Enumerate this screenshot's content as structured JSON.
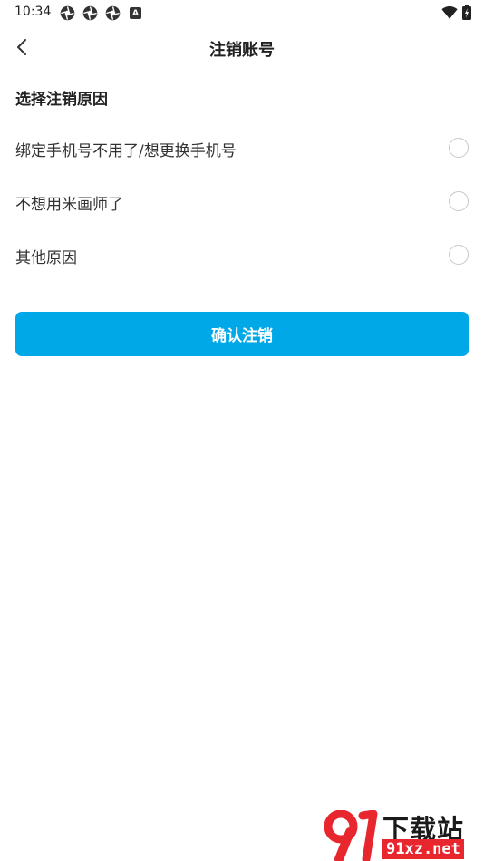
{
  "status_bar": {
    "time": "10:34",
    "notification_icons": [
      "aperture-icon",
      "aperture-icon",
      "aperture-icon",
      "a-box-icon"
    ],
    "a_icon_letter": "A",
    "right_icons": [
      "wifi-icon",
      "battery-icon"
    ]
  },
  "header": {
    "back_icon": "chevron-left-icon",
    "title": "注销账号"
  },
  "section": {
    "title": "选择注销原因"
  },
  "reasons": [
    {
      "label": "绑定手机号不用了/想更换手机号",
      "selected": false
    },
    {
      "label": "不想用米画师了",
      "selected": false
    },
    {
      "label": "其他原因",
      "selected": false
    }
  ],
  "confirm_button": {
    "label": "确认注销",
    "color": "#00a8e8"
  },
  "watermark": {
    "title": "下载站",
    "url": "91xz.net",
    "accent": "#e8262e"
  }
}
